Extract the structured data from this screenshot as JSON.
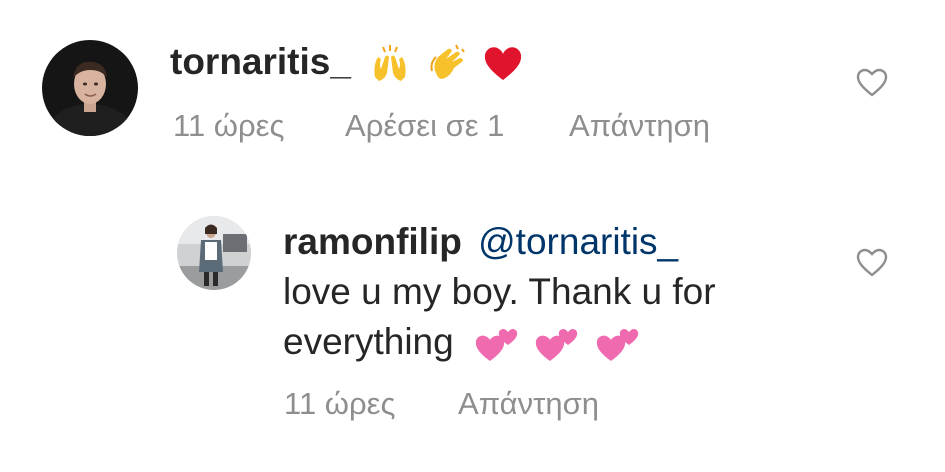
{
  "comments": [
    {
      "username": "tornaritis_",
      "emojis": [
        "raising-hands-emoji",
        "clapping-hands-emoji",
        "red-heart-emoji"
      ],
      "meta": {
        "time": "11 ώρες",
        "likes": "Αρέσει σε 1",
        "reply": "Απάντηση"
      },
      "avatar_icon": "profile-photo"
    }
  ],
  "replies": [
    {
      "username": "ramonfilip",
      "mention": "@tornaritis_",
      "text_line1": "love u my boy. Thank u for",
      "text_line2": "everything",
      "emojis": [
        "two-hearts-emoji",
        "two-hearts-emoji",
        "two-hearts-emoji"
      ],
      "meta": {
        "time": "11 ώρες",
        "reply": "Απάντηση"
      },
      "avatar_icon": "profile-photo"
    }
  ],
  "colors": {
    "text": "#262626",
    "meta": "#8e8e8e",
    "mention": "#003569",
    "heart_outline": "#8e8e8e"
  }
}
